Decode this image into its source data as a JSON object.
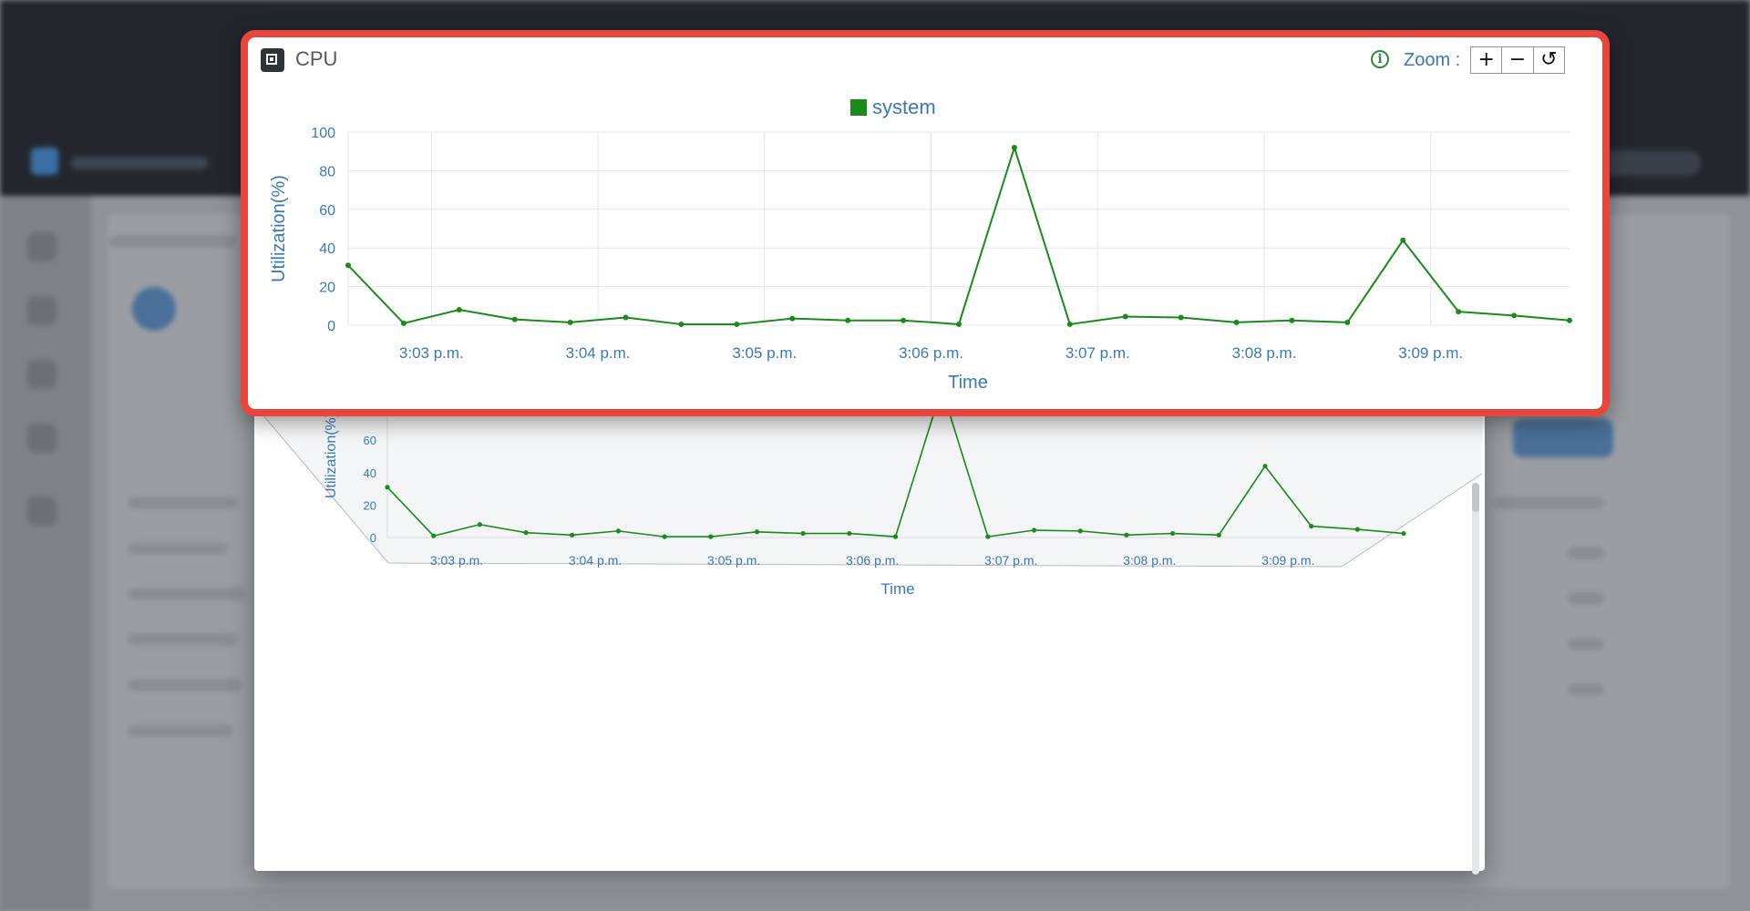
{
  "panel": {
    "title": "CPU",
    "zoom_label": "Zoom :",
    "zoom_in_glyph": "+",
    "zoom_out_glyph": "−",
    "zoom_reset_glyph": "↺",
    "info_glyph": "i"
  },
  "colors": {
    "highlight_border": "#e8463c",
    "series": "#1a8a1a",
    "axis_text": "#3a78b8",
    "grid": "#e3e6ea"
  },
  "icons": [
    "cpu-icon",
    "info-icon",
    "zoom-in-icon",
    "zoom-out-icon",
    "zoom-reset-icon"
  ],
  "chart_data": {
    "type": "line",
    "legend": [
      "system"
    ],
    "legend_placement": "top-center",
    "xlabel": "Time",
    "ylabel": "Utilization(%)",
    "ylim": [
      0,
      100
    ],
    "yticks": [
      0,
      20,
      40,
      60,
      80,
      100
    ],
    "xtick_labels": [
      "3:03 p.m.",
      "3:04 p.m.",
      "3:05 p.m.",
      "3:06 p.m.",
      "3:07 p.m.",
      "3:08 p.m.",
      "3:09 p.m."
    ],
    "grid": true,
    "x": [
      "3:02:30",
      "3:02:50",
      "3:03:10",
      "3:03:30",
      "3:03:50",
      "3:04:10",
      "3:04:30",
      "3:04:50",
      "3:05:10",
      "3:05:30",
      "3:05:50",
      "3:06:10",
      "3:06:30",
      "3:06:50",
      "3:07:10",
      "3:07:30",
      "3:07:50",
      "3:08:10",
      "3:08:30",
      "3:08:50",
      "3:09:10",
      "3:09:30",
      "3:09:50"
    ],
    "series": [
      {
        "name": "system",
        "values": [
          31,
          1,
          8,
          3,
          1.5,
          4,
          0.5,
          0.5,
          3.5,
          2.5,
          2.5,
          0.5,
          92,
          0.5,
          4.5,
          4,
          1.5,
          2.5,
          1.5,
          44,
          7,
          5,
          2.5
        ]
      }
    ]
  }
}
